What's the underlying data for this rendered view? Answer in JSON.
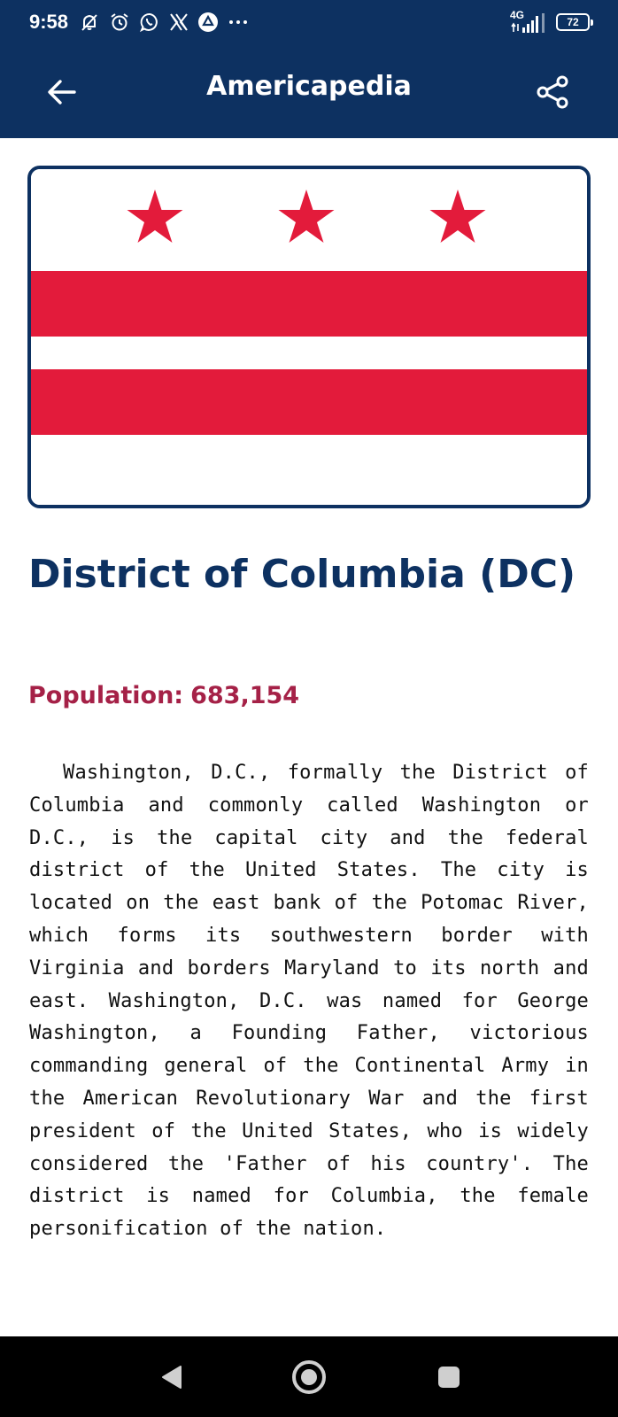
{
  "status_bar": {
    "time": "9:58",
    "icons": [
      "notification-muted-icon",
      "alarm-icon",
      "whatsapp-icon",
      "x-icon",
      "drive-icon",
      "more-dots-icon"
    ],
    "network": "4G",
    "battery": "72"
  },
  "app_bar": {
    "title": "Americapedia",
    "back_icon": "arrow-left-icon",
    "share_icon": "share-icon"
  },
  "flag": {
    "description_colors": {
      "red": "#e31b3b",
      "white": "#ffffff",
      "border": "#0d3161"
    }
  },
  "state": {
    "name": "District of Columbia (DC)",
    "population_label": "Population:",
    "population_value": "683,154",
    "description": "Washington, D.C., formally the District of Columbia and commonly called Washington or D.C., is the capital city and the federal district of the United States. The city is located on the east bank of the Potomac River, which forms its southwestern border with Virginia and borders Maryland to its north and east. Washington, D.C. was named for George Washington, a Founding Father, victorious commanding general of the Continental Army in the American Revolutionary War and the first president of the United States, who is widely considered the 'Father of his country'. The district is named for Columbia, the female personification of the nation."
  },
  "nav_bar": {
    "buttons": [
      "back-triangle-icon",
      "home-circle-icon",
      "recents-square-icon"
    ]
  },
  "colors": {
    "navy": "#0d3161",
    "crimson": "#a52147",
    "flag_red": "#e31b3b"
  }
}
